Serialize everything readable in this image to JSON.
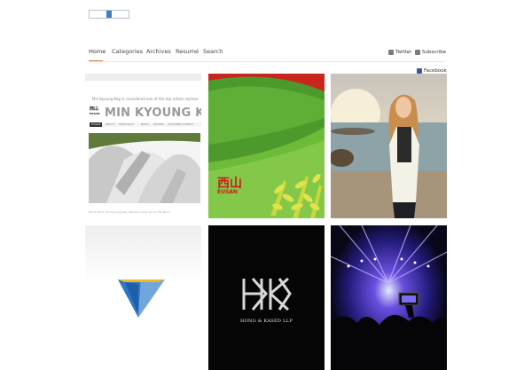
{
  "nav": {
    "items": [
      {
        "label": "Home",
        "active": true
      },
      {
        "label": "Categories"
      },
      {
        "label": "Archives"
      },
      {
        "label": "Resumé"
      },
      {
        "label": "Search"
      }
    ],
    "accent": "#e07b3a"
  },
  "social": {
    "twitter": {
      "label": "Twitter",
      "icon": "twitter-icon"
    },
    "subscribe": {
      "label": "Subscribe",
      "icon": "rss-icon"
    },
    "facebook": {
      "label": "Facebook",
      "icon": "facebook-icon"
    }
  },
  "tiles": {
    "t1": {
      "intro": "Min Kyoung-Kap is considered one of the top artists represe",
      "logo_text": "西山",
      "logo_sub": "EUSAN",
      "heading": "MIN KYOUNG KA",
      "menu": [
        "EUSAN",
        "ABOUT",
        "PORTFOLIO",
        "NEWS",
        "REVIEW",
        "UPCOMING EVENTS"
      ],
      "caption_left": "06.11.2013: Min Kyoung-Kap: Nature's Quiet Joy of The Moon",
      "caption_right": "06.11.2013: Eusan's Artistic Journey of Nature Various works of Korea"
    },
    "t2": {
      "logo_text": "西山",
      "logo_sub": "EUSAN"
    },
    "t5": {
      "logo_text": "HONG & KASED LLP"
    }
  }
}
